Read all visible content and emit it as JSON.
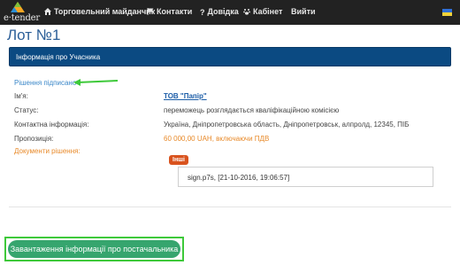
{
  "navbar": {
    "brand": "e·tender",
    "items": [
      {
        "label": "Торговельний майданчик",
        "icon": "home-icon"
      },
      {
        "label": "Контакти",
        "icon": "flag-icon"
      },
      {
        "label": "Довідка",
        "icon": "question-icon"
      },
      {
        "label": "Кабінет",
        "icon": "paw-icon"
      },
      {
        "label": "Вийти",
        "icon": ""
      }
    ],
    "language_flag": "ukraine-flag-icon"
  },
  "page": {
    "title": "Лот №1",
    "panel_title": "Інформація про Учасника"
  },
  "decision": {
    "signed_link": "Рішення підписано",
    "rows": [
      {
        "label": "Ім'я:",
        "value": "ТОВ \"Папір\""
      },
      {
        "label": "Статус:",
        "value": "переможець розглядається кваліфікаційною комісією"
      },
      {
        "label": "Контактна інформація:",
        "value": "Україна, Дніпропетровська область, Дніпропетровськ, алпролд, 12345, ПІБ"
      },
      {
        "label": "Пропозиція:",
        "value": "60 000,00 UAH, включаючи ПДВ"
      }
    ],
    "documents_label": "Документи рішення:",
    "doc_badge": "Інші",
    "doc_file": "sign.p7s, [21-10-2016, 19:06:57]"
  },
  "actions": {
    "upload_button": "Завантаження інформації про постачальника"
  },
  "colors": {
    "navbar": "#222222",
    "panel": "#0b4a82",
    "link": "#3a87c8",
    "accent_orange": "#e88a2a",
    "badge": "#d9531e",
    "button": "#36a56e",
    "highlight": "#3ec93a"
  }
}
